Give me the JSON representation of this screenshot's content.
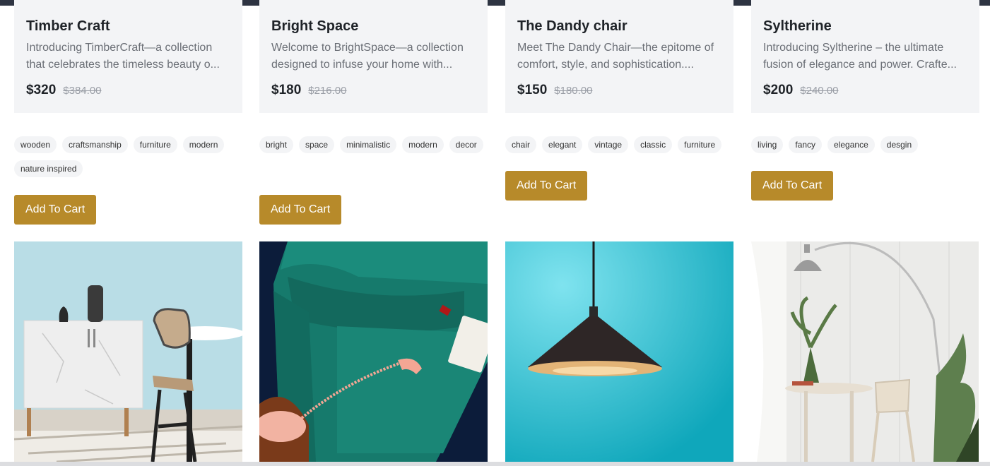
{
  "products": [
    {
      "title": "Timber Craft",
      "desc_line1": "Introducing TimberCraft—a collection",
      "desc_line2": "that celebrates the timeless beauty o...",
      "price": "$320",
      "old_price": "$384.00",
      "tags": [
        "wooden",
        "craftsmanship",
        "furniture",
        "modern",
        "nature inspired"
      ],
      "button": "Add To Cart"
    },
    {
      "title": "Bright Space",
      "desc_line1": "Welcome to BrightSpace—a collection",
      "desc_line2": "designed to infuse your home with...",
      "price": "$180",
      "old_price": "$216.00",
      "tags": [
        "bright",
        "space",
        "minimalistic",
        "modern",
        "decor"
      ],
      "button": "Add To Cart"
    },
    {
      "title": "The Dandy chair",
      "desc_line1": "Meet The Dandy Chair—the epitome of",
      "desc_line2": "comfort, style, and sophistication....",
      "price": "$150",
      "old_price": "$180.00",
      "tags": [
        "chair",
        "elegant",
        "vintage",
        "classic",
        "furniture"
      ],
      "button": "Add To Cart"
    },
    {
      "title": "Syltherine",
      "desc_line1": "Introducing Syltherine – the ultimate",
      "desc_line2": "fusion of elegance and power. Crafte...",
      "price": "$200",
      "old_price": "$240.00",
      "tags": [
        "living",
        "fancy",
        "elegance",
        "desgin"
      ],
      "button": "Add To Cart"
    }
  ],
  "colors": {
    "accent": "#b78a2a",
    "card_bg": "#f3f4f6",
    "topbar": "#2e3442"
  }
}
